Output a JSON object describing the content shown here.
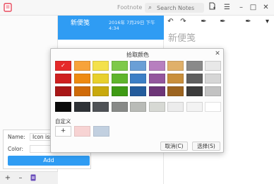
{
  "app": {
    "title": "Footnote",
    "search_placeholder": "Search Notes",
    "logo_color": "#e8495d",
    "accent": "#2f9cf3"
  },
  "note_list": {
    "selected": {
      "title": "新便笺",
      "date": "2016年 7月29日 下午 4:34"
    }
  },
  "editor": {
    "title": "新便笺"
  },
  "tag_dialog": {
    "name_label": "Name:",
    "name_value": "Icon issu",
    "color_label": "Color:",
    "add_label": "Add"
  },
  "picker": {
    "title": "拾取颜色",
    "custom_label": "自定义",
    "add_symbol": "+",
    "cancel_label": "取消(C)",
    "ok_label": "选择(S)",
    "selected_color": "#e52a2a",
    "colors": [
      [
        "#e52a2a",
        "#f7a33a",
        "#f4e14a",
        "#7ec94a",
        "#6a9fd6",
        "#b77fbf",
        "#e0b06a",
        "#8a8a8a",
        "#e8e8e8"
      ],
      [
        "#cf1f1f",
        "#ee8a10",
        "#e8d02c",
        "#5fb52c",
        "#3d7fc6",
        "#94569d",
        "#c98f3c",
        "#5f5f5f",
        "#d6d6d6"
      ],
      [
        "#a81616",
        "#cf6a08",
        "#c9a90d",
        "#3e9a14",
        "#245c9c",
        "#6d3577",
        "#9c6420",
        "#3b3b3b",
        "#c2c2c2"
      ]
    ],
    "grays": [
      "#0a0a0a",
      "#2e3236",
      "#4f5256",
      "#888a88",
      "#b9bbb7",
      "#d7d9d4",
      "#ececec",
      "#f3f3f3",
      "#ffffff"
    ],
    "custom_colors": [
      "#f7d3d3",
      "#c2d0e0"
    ]
  }
}
